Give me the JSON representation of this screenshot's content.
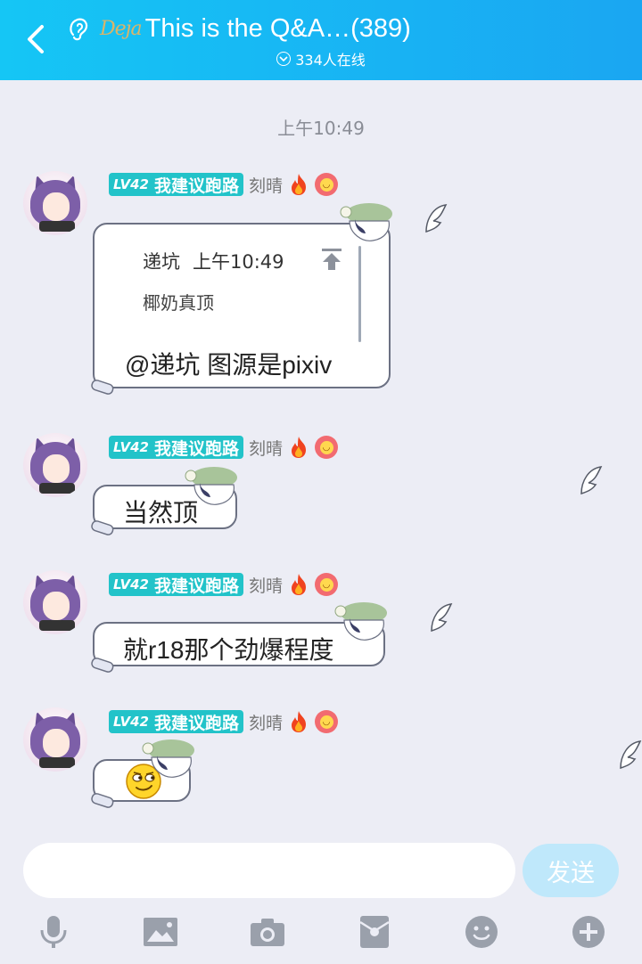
{
  "header": {
    "title": "This is the Q&A…(389)",
    "logo_text": "Deja",
    "online": "334人在线"
  },
  "time_label": "上午10:49",
  "messages": [
    {
      "level": "LV42",
      "honor": "我建议跑路",
      "nick": "刻晴",
      "quote": {
        "author": "递坑",
        "time": "上午10:49",
        "body": "椰奶真顶"
      },
      "text": "@递坑 图源是pixiv"
    },
    {
      "level": "LV42",
      "honor": "我建议跑路",
      "nick": "刻晴",
      "text": "当然顶"
    },
    {
      "level": "LV42",
      "honor": "我建议跑路",
      "nick": "刻晴",
      "text": "就r18那个劲爆程度"
    },
    {
      "level": "LV42",
      "honor": "我建议跑路",
      "nick": "刻晴",
      "emoji": "smirk-face"
    }
  ],
  "input": {
    "value": "",
    "placeholder": ""
  },
  "send_label": "发送",
  "toolbar": [
    "mic-icon",
    "image-icon",
    "camera-icon",
    "red-packet-icon",
    "emoji-icon",
    "plus-icon"
  ],
  "colors": {
    "header_start": "#15c6f5",
    "header_end": "#1aa6f2",
    "level_badge": "#22c3c9",
    "send_disabled": "#bfe8fb",
    "toolbar_icon": "#9aa0ab"
  }
}
